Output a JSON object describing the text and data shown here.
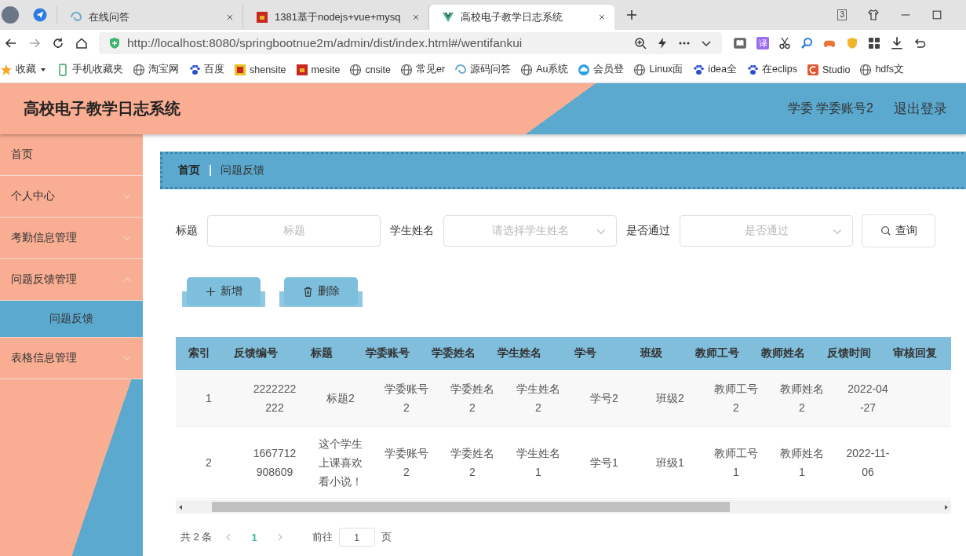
{
  "browser": {
    "tabs": [
      {
        "title": "在线问答",
        "selected": false,
        "kind": "swirl"
      },
      {
        "title": "1381基于nodejs+vue+mysq",
        "selected": false,
        "kind": "red"
      },
      {
        "title": "高校电子教学日志系统",
        "selected": true,
        "kind": "vue"
      }
    ],
    "window_badge": "3",
    "url": "http://localhost:8080/springbootnue2m/admin/dist/index.html#/wentifankui",
    "translate_label": "译",
    "bookmarks": [
      {
        "label": "收藏",
        "kind": "star"
      },
      {
        "label": "手机收藏夹",
        "kind": "phone"
      },
      {
        "label": "淘宝网",
        "kind": "globe"
      },
      {
        "label": "百度",
        "kind": "paw"
      },
      {
        "label": "shensite",
        "kind": "yellow"
      },
      {
        "label": "mesite",
        "kind": "red"
      },
      {
        "label": "cnsite",
        "kind": "globe"
      },
      {
        "label": "常见er",
        "kind": "globe"
      },
      {
        "label": "源码问答",
        "kind": "swirl"
      },
      {
        "label": "Au系统",
        "kind": "globe"
      },
      {
        "label": "会员登",
        "kind": "cloud"
      },
      {
        "label": "Linux面",
        "kind": "globe"
      },
      {
        "label": "idea全",
        "kind": "paw"
      },
      {
        "label": "在eclips",
        "kind": "paw"
      },
      {
        "label": "Studio",
        "kind": "orange"
      },
      {
        "label": "hdfs文",
        "kind": "globe"
      }
    ]
  },
  "header": {
    "title": "高校电子教学日志系统",
    "user": "学委 学委账号2",
    "logout": "退出登录"
  },
  "sidebar": {
    "items": [
      {
        "label": "首页",
        "kind": "link"
      },
      {
        "label": "个人中心",
        "kind": "menu",
        "expanded": false
      },
      {
        "label": "考勤信息管理",
        "kind": "menu",
        "expanded": false
      },
      {
        "label": "问题反馈管理",
        "kind": "menu",
        "expanded": true,
        "children": [
          {
            "label": "问题反馈",
            "selected": true
          }
        ]
      },
      {
        "label": "表格信息管理",
        "kind": "menu",
        "expanded": false
      }
    ]
  },
  "breadcrumb": [
    "首页",
    "问题反馈"
  ],
  "search": {
    "fields": [
      {
        "label": "标题",
        "placeholder": "标题",
        "kind": "input"
      },
      {
        "label": "学生姓名",
        "placeholder": "请选择学生姓名",
        "kind": "select"
      },
      {
        "label": "是否通过",
        "placeholder": "是否通过",
        "kind": "select"
      }
    ],
    "button": "查询"
  },
  "actions": [
    {
      "label": "新增",
      "kind": "add"
    },
    {
      "label": "删除",
      "kind": "delete"
    }
  ],
  "table": {
    "columns": [
      "索引",
      "反馈编号",
      "标题",
      "学委账号",
      "学委姓名",
      "学生姓名",
      "学号",
      "班级",
      "教师工号",
      "教师姓名",
      "反馈时间",
      "审核回复"
    ],
    "rows": [
      [
        "1",
        "2222222222",
        "标题2",
        "学委账号2",
        "学委姓名2",
        "学生姓名2",
        "学号2",
        "班级2",
        "教师工号2",
        "教师姓名2",
        "2022-04-27"
      ],
      [
        "2",
        "1667712908609",
        "这个学生上课喜欢看小说！",
        "学委账号2",
        "学委姓名2",
        "学生姓名1",
        "学号1",
        "班级1",
        "教师工号1",
        "教师姓名1",
        "2022-11-06"
      ]
    ]
  },
  "pagination": {
    "total": "共 2 条",
    "pages": [
      {
        "label": "1",
        "selected": true
      }
    ],
    "goto_label": "前往",
    "goto_value": "1",
    "page_suffix": "页"
  }
}
